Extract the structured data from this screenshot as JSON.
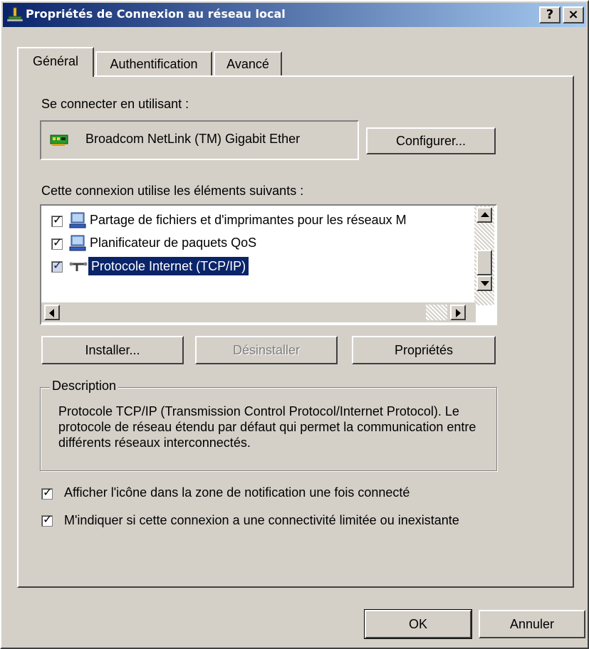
{
  "window": {
    "title": "Propriétés de Connexion au réseau local",
    "help_btn": "?",
    "close_btn": "×"
  },
  "tabs": [
    {
      "label": "Général",
      "selected": true
    },
    {
      "label": "Authentification",
      "selected": false
    },
    {
      "label": "Avancé",
      "selected": false
    }
  ],
  "connect_using": {
    "label": "Se connecter en utilisant :",
    "adapter": "Broadcom NetLink (TM) Gigabit Ether",
    "adapter_icon": "network-card-icon",
    "configure_button": "Configurer..."
  },
  "components": {
    "label": "Cette connexion utilise les éléments suivants :",
    "items": [
      {
        "label": "Partage de fichiers et d'imprimantes pour les réseaux M",
        "checked": true,
        "icon": "network-service-icon",
        "selected": false
      },
      {
        "label": "Planificateur de paquets QoS",
        "checked": true,
        "icon": "network-service-icon",
        "selected": false
      },
      {
        "label": "Protocole Internet (TCP/IP)",
        "checked": true,
        "icon": "protocol-icon",
        "selected": true
      }
    ]
  },
  "buttons": {
    "install": "Installer...",
    "uninstall": "Désinstaller",
    "properties": "Propriétés"
  },
  "description": {
    "label": "Description",
    "text": "Protocole TCP/IP (Transmission Control Protocol/Internet Protocol). Le protocole de réseau étendu par défaut qui permet la communication entre différents réseaux interconnectés."
  },
  "options": [
    {
      "label": "Afficher l'icône dans la zone de notification une fois connecté",
      "checked": true
    },
    {
      "label": "M'indiquer si cette connexion a une connectivité limitée ou inexistante",
      "checked": true
    }
  ],
  "footer": {
    "ok": "OK",
    "cancel": "Annuler"
  },
  "colors": {
    "title_start": "#0a246a",
    "title_end": "#a6caf0",
    "selection": "#0a246a",
    "face": "#d4d0c8"
  }
}
